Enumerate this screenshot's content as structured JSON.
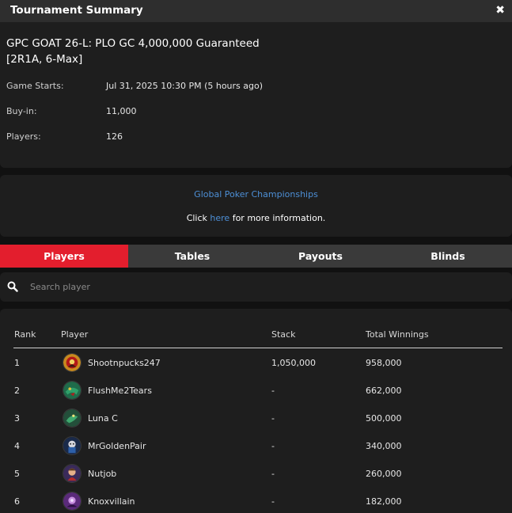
{
  "window": {
    "title": "Tournament Summary",
    "close_glyph": "✖"
  },
  "tournament": {
    "name": "GPC GOAT 26-L: PLO GC 4,000,000 Guaranteed [2R1A, 6-Max]",
    "details": [
      {
        "label": "Game Starts:",
        "value": "Jul 31, 2025 10:30 PM (5 hours ago)"
      },
      {
        "label": "Buy-in:",
        "value": "11,000"
      },
      {
        "label": "Players:",
        "value": "126"
      }
    ]
  },
  "organizer": {
    "name": "Global Poker Championships",
    "more_prefix": "Click",
    "more_link": "here",
    "more_suffix": "for more information."
  },
  "tabs": [
    {
      "label": "Players",
      "active": true
    },
    {
      "label": "Tables",
      "active": false
    },
    {
      "label": "Payouts",
      "active": false
    },
    {
      "label": "Blinds",
      "active": false
    }
  ],
  "search": {
    "placeholder": "Search player",
    "icon": "search-icon"
  },
  "table": {
    "headers": {
      "rank": "Rank",
      "player": "Player",
      "stack": "Stack",
      "winnings": "Total Winnings"
    },
    "rows": [
      {
        "rank": "1",
        "player": "Shootnpucks247",
        "stack": "1,050,000",
        "winnings": "958,000"
      },
      {
        "rank": "2",
        "player": "FlushMe2Tears",
        "stack": "-",
        "winnings": "662,000"
      },
      {
        "rank": "3",
        "player": "Luna C",
        "stack": "-",
        "winnings": "500,000"
      },
      {
        "rank": "4",
        "player": "MrGoldenPair",
        "stack": "-",
        "winnings": "340,000"
      },
      {
        "rank": "5",
        "player": "Nutjob",
        "stack": "-",
        "winnings": "260,000"
      },
      {
        "rank": "6",
        "player": "Knoxvillain",
        "stack": "-",
        "winnings": "182,000"
      }
    ]
  },
  "colors": {
    "accent": "#e31e2d",
    "link": "#4d8fd6",
    "panel": "#1e1e1e",
    "background": "#111111"
  }
}
